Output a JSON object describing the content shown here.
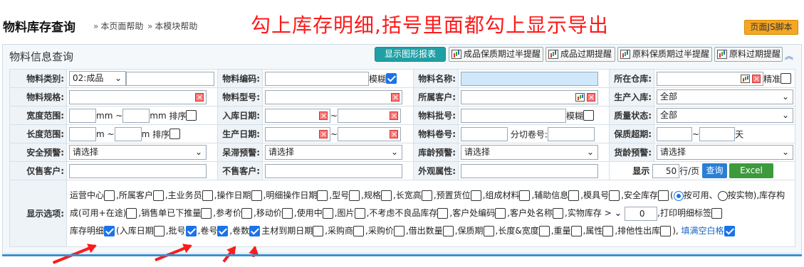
{
  "header": {
    "title": "物料库存查询",
    "help_page": "本页面帮助",
    "help_module": "本模块帮助",
    "annotation": "勾上库存明细,括号里面都勾上显示导出",
    "js_script": "页面JS脚本"
  },
  "panel": {
    "title": "物料信息查询",
    "graph_report": "显示图形报表",
    "alerts": [
      "成品保质期过半提醒",
      "成品过期提醒",
      "原料保质期过半提醒",
      "原料过期提醒"
    ]
  },
  "form": {
    "material_type": {
      "label": "物料类别:",
      "value": "02:成品"
    },
    "material_code": {
      "label": "物料编码:"
    },
    "fuzzy1": "模糊",
    "material_name": {
      "label": "物料名称:"
    },
    "warehouse": {
      "label": "所在仓库:"
    },
    "exact": "精准",
    "material_spec": {
      "label": "物料规格:"
    },
    "material_model": {
      "label": "物料型号:"
    },
    "customer": {
      "label": "所属客户:"
    },
    "inbound_from_prod": {
      "label": "生产入库:",
      "value": "全部"
    },
    "width_range": {
      "label": "宽度范围:",
      "unit_from": "mm ~",
      "unit_to": "mm",
      "sort": "排序"
    },
    "inbound_date": {
      "label": "入库日期:"
    },
    "tilde": "~",
    "batch_no": {
      "label": "物料批号:"
    },
    "fuzzy2": "模糊",
    "quality_status": {
      "label": "质量状态:",
      "value": "全部"
    },
    "length_range": {
      "label": "长度范围:",
      "unit_from": "m ~",
      "unit_to": "m",
      "sort": "排序"
    },
    "production_date": {
      "label": "生产日期:"
    },
    "roll_no": {
      "label": "物料卷号:",
      "split_label": "分切卷号:"
    },
    "shelf_expire": {
      "label": "保质超期:",
      "unit": "天"
    },
    "safety_alert": {
      "label": "安全预警:",
      "value": "请选择"
    },
    "stagnant_alert": {
      "label": "呆滞预警:",
      "value": "请选择"
    },
    "age_alert": {
      "label": "库龄预警:",
      "value": "请选择"
    },
    "goods_age_alert": {
      "label": "货龄预警:",
      "value": "请选择"
    },
    "only_customer": {
      "label": "仅售客户:"
    },
    "not_customer": {
      "label": "不售客户:"
    },
    "appearance": {
      "label": "外观属性:"
    },
    "display": {
      "label": "显示",
      "value": "50",
      "unit": "行/页"
    },
    "search_btn": "查询",
    "excel_btn": "Excel"
  },
  "display_options": {
    "label": "显示选项:",
    "line1": [
      "运营中心",
      ",所属客户",
      ",主业务员",
      ",操作日期",
      ",明细操作日期",
      ",型号",
      ",规格",
      ",长宽高",
      ",预置货位",
      ",组成材料",
      ",辅助信息",
      ",模具号",
      ",安全库存"
    ],
    "radio_avail": "按可用、",
    "radio_phys": "按实物),库存构",
    "line2": [
      "成(可用+在途)",
      ",销售单已下推量",
      ",参考价",
      ",移动价",
      ",使用中",
      ",图片",
      ",不考虑不良品库存",
      ",客户处编码",
      ",客户处名称"
    ],
    "physical_stock": ",实物库存 >",
    "physical_value": "0",
    "print_label": ",打印明细标签",
    "line3": [
      {
        "text": "库存明细",
        "checked": true
      },
      {
        "text": "(入库日期",
        "checked": false
      },
      {
        "text": ",批号",
        "checked": true
      },
      {
        "text": ",卷号",
        "checked": true
      },
      {
        "text": ",卷数",
        "checked": true
      },
      {
        "text": "主材到期日期",
        "checked": false
      },
      {
        "text": ",采购商",
        "checked": false
      },
      {
        "text": ",采购价",
        "checked": false
      },
      {
        "text": ",借出数量",
        "checked": false
      },
      {
        "text": ",保质期",
        "checked": false
      },
      {
        "text": ",长度&宽度",
        "checked": false
      },
      {
        "text": ",重量",
        "checked": false
      },
      {
        "text": ",属性",
        "checked": false
      },
      {
        "text": ",排他性出库",
        "checked": false
      }
    ],
    "close_paren": "),",
    "fill_blank": "填满空白格"
  }
}
